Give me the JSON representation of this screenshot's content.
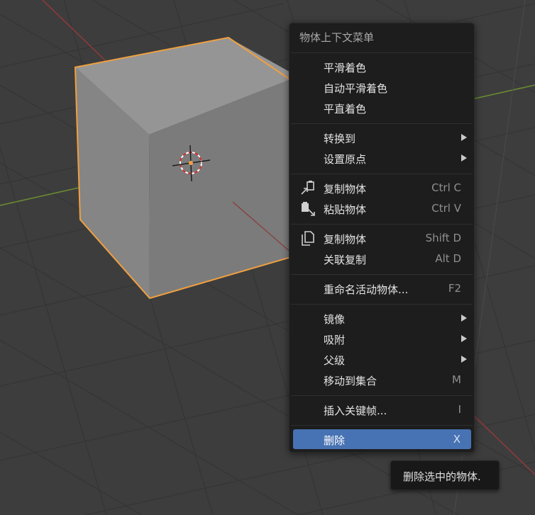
{
  "context_menu": {
    "title": "物体上下文菜单",
    "groups": [
      [
        {
          "label": "平滑着色",
          "shortcut": "",
          "submenu": false,
          "icon": ""
        },
        {
          "label": "自动平滑着色",
          "shortcut": "",
          "submenu": false,
          "icon": ""
        },
        {
          "label": "平直着色",
          "shortcut": "",
          "submenu": false,
          "icon": ""
        }
      ],
      [
        {
          "label": "转换到",
          "shortcut": "",
          "submenu": true,
          "icon": ""
        },
        {
          "label": "设置原点",
          "shortcut": "",
          "submenu": true,
          "icon": ""
        }
      ],
      [
        {
          "label": "复制物体",
          "shortcut": "Ctrl C",
          "submenu": false,
          "icon": "copy-to-buffer-icon"
        },
        {
          "label": "粘贴物体",
          "shortcut": "Ctrl V",
          "submenu": false,
          "icon": "paste-from-buffer-icon"
        }
      ],
      [
        {
          "label": "复制物体",
          "shortcut": "Shift D",
          "submenu": false,
          "icon": "duplicate-icon"
        },
        {
          "label": "关联复制",
          "shortcut": "Alt D",
          "submenu": false,
          "icon": ""
        }
      ],
      [
        {
          "label": "重命名活动物体...",
          "shortcut": "F2",
          "submenu": false,
          "icon": ""
        }
      ],
      [
        {
          "label": "镜像",
          "shortcut": "",
          "submenu": true,
          "icon": ""
        },
        {
          "label": "吸附",
          "shortcut": "",
          "submenu": true,
          "icon": ""
        },
        {
          "label": "父级",
          "shortcut": "",
          "submenu": true,
          "icon": ""
        },
        {
          "label": "移动到集合",
          "shortcut": "M",
          "submenu": false,
          "icon": ""
        }
      ],
      [
        {
          "label": "插入关键帧...",
          "shortcut": "I",
          "submenu": false,
          "icon": ""
        }
      ],
      [
        {
          "label": "删除",
          "shortcut": "X",
          "submenu": false,
          "icon": "",
          "active": true
        }
      ]
    ]
  },
  "tooltip": {
    "text": "删除选中的物体."
  },
  "colors": {
    "viewport_bg": "#3d3d3d",
    "grid_line": "#353535",
    "x_axis": "#8b3a3a",
    "y_axis": "#6a8a33",
    "selection_outline": "#f0a040",
    "menu_bg": "#1d1d1d",
    "highlight": "#4772b3"
  }
}
